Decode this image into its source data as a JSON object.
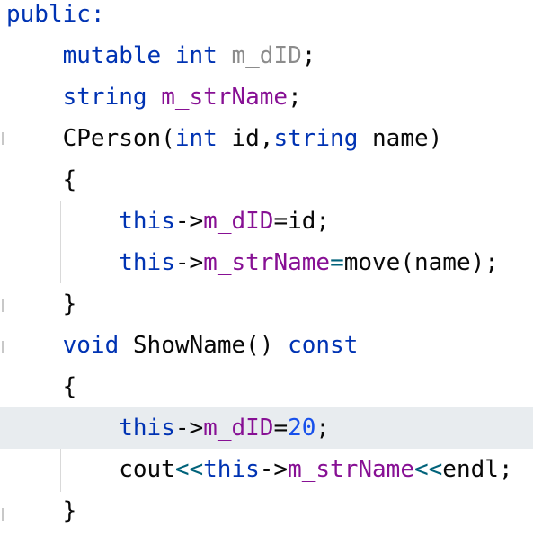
{
  "editor": {
    "language": "cpp",
    "colors": {
      "keyword": "#0033b3",
      "field": "#871094",
      "number": "#1750eb",
      "operator": "#00627a",
      "unused": "#8c8c8c",
      "plain": "#080808",
      "current_line": "#e8ecef"
    },
    "current_line_index": 10,
    "lines": [
      {
        "tokens": [
          {
            "t": "public:",
            "c": "kw"
          }
        ]
      },
      {
        "tokens": [
          {
            "t": "    ",
            "c": "plain"
          },
          {
            "t": "mutable",
            "c": "kw"
          },
          {
            "t": " ",
            "c": "plain"
          },
          {
            "t": "int",
            "c": "kw"
          },
          {
            "t": " ",
            "c": "plain"
          },
          {
            "t": "m_dID",
            "c": "gray"
          },
          {
            "t": ";",
            "c": "plain"
          }
        ]
      },
      {
        "tokens": [
          {
            "t": "    ",
            "c": "plain"
          },
          {
            "t": "string",
            "c": "kw"
          },
          {
            "t": " ",
            "c": "plain"
          },
          {
            "t": "m_strName",
            "c": "field"
          },
          {
            "t": ";",
            "c": "plain"
          }
        ]
      },
      {
        "tokens": [
          {
            "t": "    CPerson(",
            "c": "plain"
          },
          {
            "t": "int",
            "c": "kw"
          },
          {
            "t": " id,",
            "c": "plain"
          },
          {
            "t": "string",
            "c": "kw"
          },
          {
            "t": " name)",
            "c": "plain"
          }
        ]
      },
      {
        "tokens": [
          {
            "t": "    {",
            "c": "plain"
          }
        ]
      },
      {
        "tokens": [
          {
            "t": "        ",
            "c": "plain"
          },
          {
            "t": "this",
            "c": "kw"
          },
          {
            "t": "->",
            "c": "plain"
          },
          {
            "t": "m_dID",
            "c": "field"
          },
          {
            "t": "=id;",
            "c": "plain"
          }
        ]
      },
      {
        "tokens": [
          {
            "t": "        ",
            "c": "plain"
          },
          {
            "t": "this",
            "c": "kw"
          },
          {
            "t": "->",
            "c": "plain"
          },
          {
            "t": "m_strName",
            "c": "field"
          },
          {
            "t": "=",
            "c": "op"
          },
          {
            "t": "move(name);",
            "c": "plain"
          }
        ]
      },
      {
        "tokens": [
          {
            "t": "    }",
            "c": "plain"
          }
        ]
      },
      {
        "tokens": [
          {
            "t": "    ",
            "c": "plain"
          },
          {
            "t": "void",
            "c": "kw"
          },
          {
            "t": " ShowName() ",
            "c": "plain"
          },
          {
            "t": "const",
            "c": "kw"
          }
        ]
      },
      {
        "tokens": [
          {
            "t": "    {",
            "c": "plain"
          }
        ]
      },
      {
        "tokens": [
          {
            "t": "        ",
            "c": "plain"
          },
          {
            "t": "this",
            "c": "kw"
          },
          {
            "t": "->",
            "c": "plain"
          },
          {
            "t": "m_dID",
            "c": "field"
          },
          {
            "t": "=",
            "c": "plain"
          },
          {
            "t": "20",
            "c": "num"
          },
          {
            "t": ";",
            "c": "plain"
          }
        ]
      },
      {
        "tokens": [
          {
            "t": "        cout",
            "c": "plain"
          },
          {
            "t": "<<",
            "c": "op"
          },
          {
            "t": "this",
            "c": "kw"
          },
          {
            "t": "->",
            "c": "plain"
          },
          {
            "t": "m_strName",
            "c": "field"
          },
          {
            "t": "<<",
            "c": "op"
          },
          {
            "t": "endl;",
            "c": "plain"
          }
        ]
      },
      {
        "tokens": [
          {
            "t": "    }",
            "c": "plain"
          }
        ]
      }
    ]
  }
}
